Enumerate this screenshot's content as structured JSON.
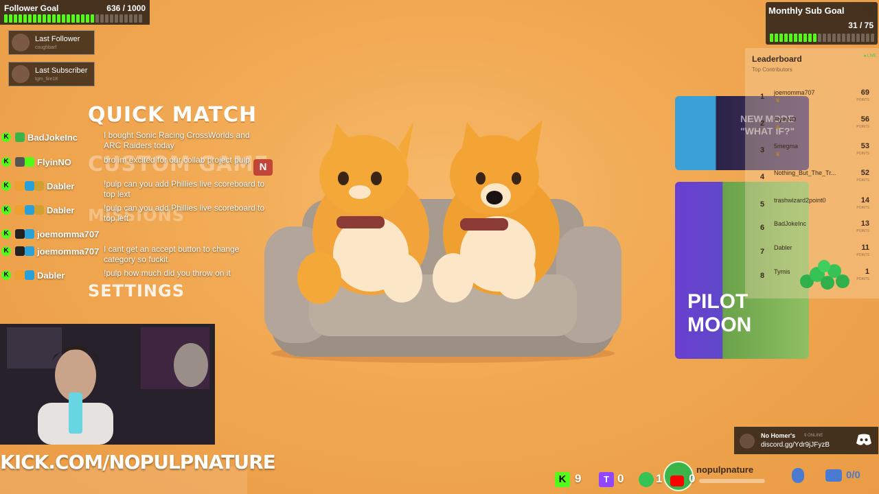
{
  "follower_goal": {
    "label": "Follower Goal",
    "count": "636 / 1000",
    "progress": 0.636
  },
  "last_follower": {
    "label": "Last Follower",
    "name": "coughbarf"
  },
  "last_subscriber": {
    "label": "Last Subscriber",
    "name": "tgm_fire18"
  },
  "menu": {
    "quick_match": "QUICK MATCH",
    "custom_game": "CUSTOM GAME",
    "missions": "MISSIONS",
    "settings": "SETTINGS",
    "badge": "N"
  },
  "chat": [
    {
      "name": "BadJokeInc",
      "message": "I bought Sonic Racing CrossWorlds and ARC Raiders today"
    },
    {
      "name": "FlyinNO",
      "message": "bro im excited for our collab project pulp"
    },
    {
      "name": "Dabler",
      "message": "!pulp can you add Phillies live scoreboard to top lext"
    },
    {
      "name": "Dabler",
      "message": "!pulp can you add Phillies live scoreboard to top left"
    },
    {
      "name": "joemomma707",
      "message": ""
    },
    {
      "name": "joemomma707",
      "message": "I cant get an accept button to change category so fuckit"
    },
    {
      "name": "Dabler",
      "message": "!pulp how much did you throw on it"
    }
  ],
  "sub_goal": {
    "label": "Monthly Sub Goal",
    "count": "31 / 75",
    "progress": 0.413
  },
  "leaderboard": {
    "title": "Leaderboard",
    "subtitle": "Top Contributors",
    "live": "● LIVE",
    "points_label": "POINTS",
    "entries": [
      {
        "rank": "1",
        "name": "joemomma707",
        "points": "69"
      },
      {
        "rank": "2",
        "name": "FlyinNO",
        "points": "56"
      },
      {
        "rank": "3",
        "name": "5megma",
        "points": "53"
      },
      {
        "rank": "4",
        "name": "Nothing_But_The_Tr...",
        "points": "52"
      },
      {
        "rank": "5",
        "name": "trashwizard2point0",
        "points": "14"
      },
      {
        "rank": "6",
        "name": "BadJokeInc",
        "points": "13"
      },
      {
        "rank": "7",
        "name": "Dabler",
        "points": "11"
      },
      {
        "rank": "8",
        "name": "Tymis",
        "points": "1"
      }
    ]
  },
  "game_cards": {
    "new_mode": "NEW MODE \"WHAT IF?\"",
    "pilot_moon": "PILOT MOON"
  },
  "discord": {
    "title": "No Homer's",
    "status": "9 ONLINE",
    "link": "discord.gg/Ydr9jJFyzB"
  },
  "kick_url": "KICK.COM/NOPULPNATURE",
  "bottom_stats": {
    "kick": "9",
    "twitch": "0",
    "other": "1",
    "youtube": "0",
    "channel": "nopulpnature",
    "ratio": "0/0"
  },
  "colors": {
    "accent_green": "#53fc18",
    "background": "#f1a852",
    "twitch": "#9146ff",
    "youtube": "#ff0000"
  }
}
